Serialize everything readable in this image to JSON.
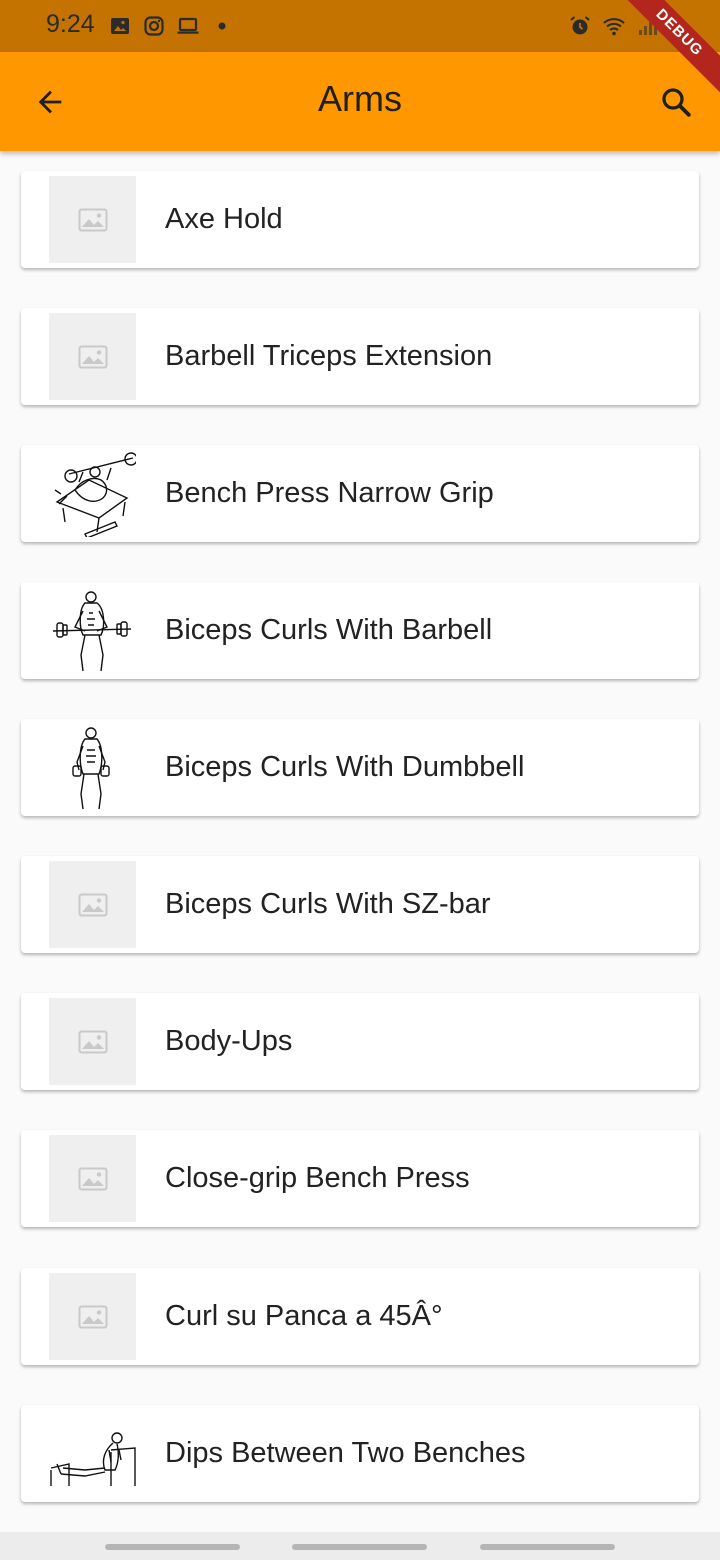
{
  "status_bar": {
    "time": "9:24",
    "left_icons": [
      "image-icon",
      "instagram-icon",
      "laptop-icon",
      "dot-icon"
    ],
    "right_icons": [
      "alarm-icon",
      "wifi-icon",
      "signal-icon"
    ]
  },
  "debug_banner": "DEBUG",
  "app_bar": {
    "title": "Arms",
    "back_icon": "arrow-back-icon",
    "search_icon": "search-icon"
  },
  "exercises": [
    {
      "name": "Axe Hold",
      "image": "placeholder"
    },
    {
      "name": "Barbell Triceps Extension",
      "image": "placeholder"
    },
    {
      "name": "Bench Press Narrow Grip",
      "image": "bench-press-drawing"
    },
    {
      "name": "Biceps Curls With Barbell",
      "image": "barbell-curl-drawing"
    },
    {
      "name": "Biceps Curls With Dumbbell",
      "image": "dumbbell-curl-drawing"
    },
    {
      "name": "Biceps Curls With SZ-bar",
      "image": "placeholder"
    },
    {
      "name": "Body-Ups",
      "image": "placeholder"
    },
    {
      "name": "Close-grip Bench Press",
      "image": "placeholder"
    },
    {
      "name": "Curl su Panca a 45Â°",
      "image": "placeholder"
    },
    {
      "name": "Dips Between Two Benches",
      "image": "dips-drawing"
    }
  ],
  "colors": {
    "status_bar": "#c47200",
    "app_bar": "#ff9800",
    "background": "#fafafa",
    "card": "#ffffff",
    "debug_ribbon": "#b3261e"
  }
}
